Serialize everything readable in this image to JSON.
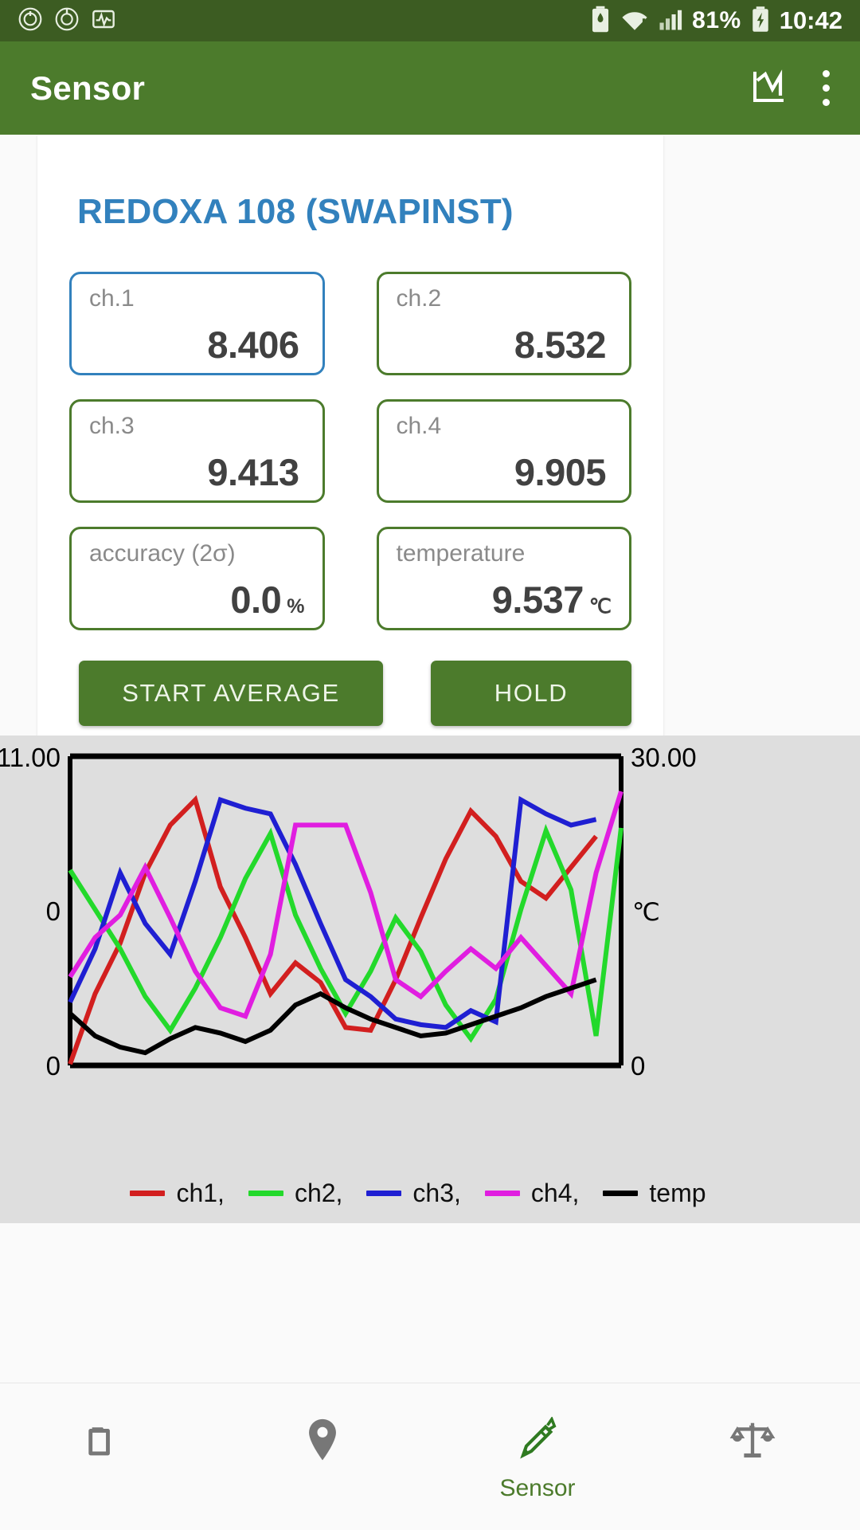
{
  "statusbar": {
    "icons": [
      "power-record-icon",
      "circle-record-icon",
      "pulse-graph-icon"
    ],
    "battery_saver_icon": "battery-saver-icon",
    "wifi_icon": "wifi-alert-icon",
    "signal_icon": "cellular-signal-icon",
    "battery_percent": "81%",
    "charging_icon": "battery-charging-icon",
    "clock": "10:42"
  },
  "appbar": {
    "title": "Sensor",
    "chart_icon": "line-chart-icon",
    "menu_icon": "overflow-menu-icon"
  },
  "main": {
    "device_title": "REDOXA 108 (SWAPINST)",
    "fields": [
      {
        "label": "ch.1",
        "value": "8.406",
        "unit": "",
        "focused": true
      },
      {
        "label": "ch.2",
        "value": "8.532",
        "unit": "",
        "focused": false
      },
      {
        "label": "ch.3",
        "value": "9.413",
        "unit": "",
        "focused": false
      },
      {
        "label": "ch.4",
        "value": "9.905",
        "unit": "",
        "focused": false
      },
      {
        "label": "accuracy (2σ)",
        "value": "0.0",
        "unit": "%",
        "focused": false
      },
      {
        "label": "temperature",
        "value": "9.537",
        "unit": "℃",
        "focused": false
      }
    ],
    "buttons": {
      "start_average": "START AVERAGE",
      "hold": "HOLD"
    }
  },
  "colors": {
    "accent_green": "#4c7b2c",
    "statusbar_green": "#3c5c22",
    "title_blue": "#3281bd",
    "focus_blue": "#3281bd",
    "field_border": "#4c7b2c",
    "chart_bg": "#dedede",
    "ch1": "#d21f1f",
    "ch2": "#23d92b",
    "ch3": "#1f1fd2",
    "ch4": "#e01ee0",
    "temp": "#000000"
  },
  "chart_data": {
    "type": "line",
    "title": "",
    "xlabel": "",
    "ylabel": "",
    "left_axis": {
      "top_label": "11.00",
      "mid_label": "0",
      "bottom_label": "0",
      "range": [
        0,
        11.0
      ]
    },
    "right_axis": {
      "top_label": "30.00",
      "mid_label": "℃",
      "bottom_label": "0",
      "range": [
        0,
        30.0
      ]
    },
    "grid": false,
    "legend_position": "bottom",
    "legend": [
      "ch1,",
      "ch2,",
      "ch3,",
      "ch4,",
      "temp"
    ],
    "x": [
      0,
      1,
      2,
      3,
      4,
      5,
      6,
      7,
      8,
      9,
      10,
      11,
      12,
      13,
      14,
      15,
      16,
      17,
      18,
      19,
      20,
      21,
      22
    ],
    "series": [
      {
        "name": "ch1",
        "color": "#d21f1f",
        "values": [
          0.05,
          2.55,
          4.35,
          6.85,
          8.55,
          9.45,
          6.35,
          4.55,
          2.55,
          3.65,
          2.95,
          1.35,
          1.25,
          3.05,
          5.25,
          7.35,
          9.05,
          8.15,
          6.55,
          5.95,
          7.05,
          8.15,
          null
        ]
      },
      {
        "name": "ch2",
        "color": "#23d92b",
        "values": [
          6.95,
          5.55,
          4.15,
          2.45,
          1.25,
          2.75,
          4.55,
          6.65,
          8.25,
          5.35,
          3.45,
          1.85,
          3.35,
          5.25,
          4.05,
          2.15,
          0.95,
          2.35,
          5.55,
          8.35,
          6.25,
          1.05,
          8.45
        ]
      },
      {
        "name": "ch3",
        "color": "#1f1fd2",
        "values": [
          2.25,
          4.15,
          6.85,
          5.05,
          3.95,
          6.55,
          9.45,
          9.15,
          8.95,
          7.15,
          5.05,
          3.05,
          2.45,
          1.65,
          1.45,
          1.35,
          1.95,
          1.55,
          9.45,
          8.95,
          8.55,
          8.75,
          null
        ]
      },
      {
        "name": "ch4",
        "color": "#e01ee0",
        "values": [
          3.15,
          4.55,
          5.35,
          7.05,
          5.25,
          3.35,
          2.05,
          1.75,
          3.95,
          8.55,
          8.55,
          8.55,
          6.15,
          3.05,
          2.45,
          3.35,
          4.15,
          3.45,
          4.55,
          3.55,
          2.55,
          6.85,
          9.75
        ]
      },
      {
        "name": "temp",
        "color": "#000000",
        "values": [
          1.85,
          1.05,
          0.65,
          0.45,
          0.95,
          1.35,
          1.15,
          0.85,
          1.25,
          2.15,
          2.55,
          2.05,
          1.65,
          1.35,
          1.05,
          1.15,
          1.45,
          1.75,
          2.05,
          2.45,
          2.75,
          3.05,
          null
        ]
      }
    ]
  },
  "bottomnav": {
    "items": [
      {
        "icon": "folder-icon",
        "label": "",
        "active": false
      },
      {
        "icon": "location-pin-icon",
        "label": "",
        "active": false
      },
      {
        "icon": "pen-sensor-icon",
        "label": "Sensor",
        "active": true
      },
      {
        "icon": "balance-scale-icon",
        "label": "",
        "active": false
      }
    ]
  }
}
